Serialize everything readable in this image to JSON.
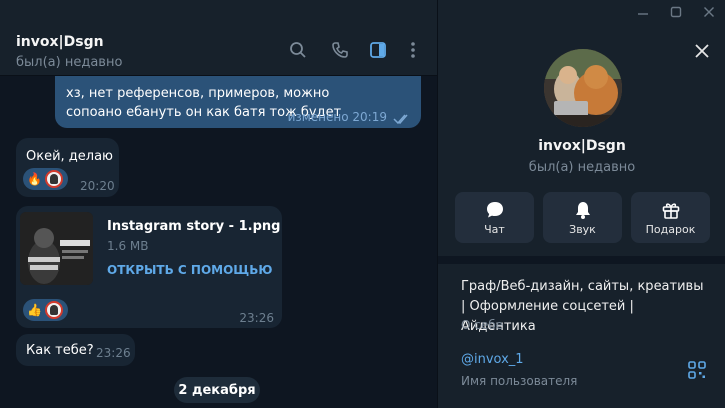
{
  "chat": {
    "title": "invox|Dsgn",
    "status": "был(а) недавно",
    "messages": [
      {
        "text": "хз, нет референсов, примеров, можно сопоано ебануть он как батя тож будет",
        "time": "изменено 20:19"
      },
      {
        "text": "Окей, делаю",
        "time": "20:20",
        "reaction": "🔥"
      },
      {
        "file_name": "Instagram story - 1.png",
        "file_size": "1.6 MB",
        "open_with": "ОТКРЫТЬ С ПОМОЩЬЮ",
        "time": "23:26",
        "reaction": "👍"
      },
      {
        "text": "Как тебе?",
        "time": "23:26"
      }
    ],
    "date_separator": "2 декабря"
  },
  "profile": {
    "name": "invox|Dsgn",
    "status": "был(а) недавно",
    "actions": [
      {
        "label": "Чат",
        "icon": "chat-bubble-icon"
      },
      {
        "label": "Звук",
        "icon": "bell-icon"
      },
      {
        "label": "Подарок",
        "icon": "gift-icon"
      }
    ],
    "bio": "Граф/Веб-дизайн, сайты, креативы | Оформление соцсетей | Айдентика",
    "bio_caption": "О себе",
    "username": "@invox_1",
    "username_caption": "Имя пользователя"
  },
  "colors": {
    "background": "#0e1621",
    "panel": "#17212b",
    "outgoing_bubble": "#2b5278",
    "incoming_bubble": "#182533",
    "accent": "#5fa9e8"
  }
}
